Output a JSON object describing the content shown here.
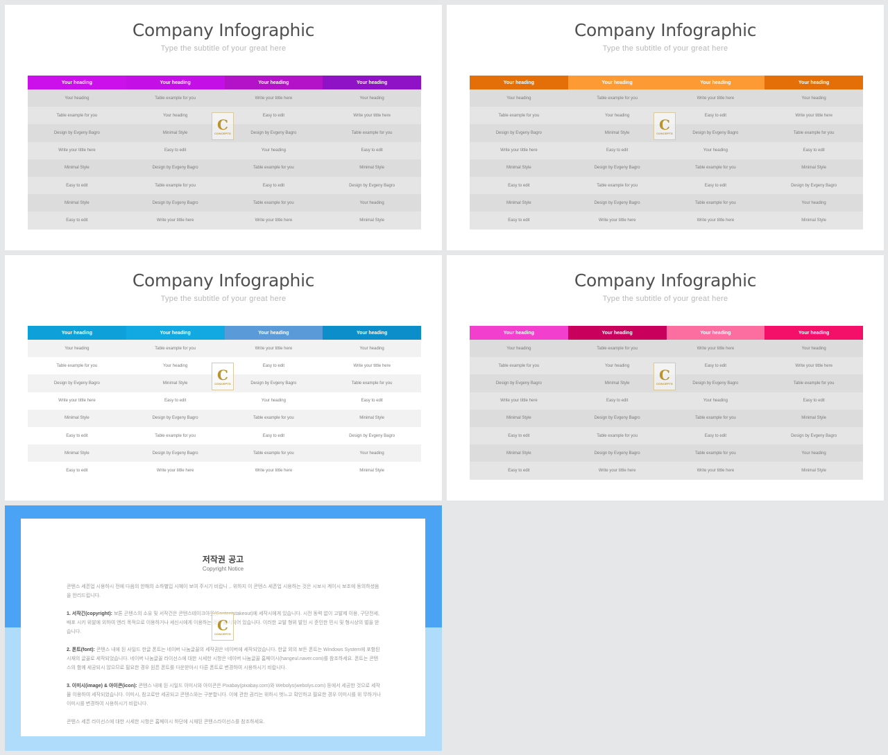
{
  "slides": [
    {
      "title": "Company Infographic",
      "subtitle": "Type the subtitle of your great here",
      "style": "gray",
      "header_colors": [
        "#cb10ec",
        "#c410e6",
        "#b412c8",
        "#8f12c6"
      ],
      "headers": [
        "Your heading",
        "Your heading",
        "Your heading",
        "Your heading"
      ],
      "rows": [
        [
          "Your heading",
          "Table example  for you",
          "Write your tittle here",
          "Your heading"
        ],
        [
          "Table example for you",
          "Your heading",
          "Easy to edit",
          "Write your tittle here"
        ],
        [
          "Design by Evgeny Bagro",
          "Minimal Style",
          "Design by Evgeny Bagro",
          "Table example  for you"
        ],
        [
          "Write your tittle here",
          "Easy to edit",
          "Your heading",
          "Easy to edit"
        ],
        [
          "Minimal Style",
          "Design by Evgeny Bagro",
          "Table example  for you",
          "Minimal Style"
        ],
        [
          "Easy to edit",
          "Table example  for you",
          "Easy to edit",
          "Design by Evgeny Bagro"
        ],
        [
          "Minimal Style",
          "Design by Evgeny Bagro",
          "Table example  for you",
          "Your heading"
        ],
        [
          "Easy to edit",
          "Write your tittle here",
          "Write your tittle here",
          "Minimal Style"
        ]
      ]
    },
    {
      "title": "Company Infographic",
      "subtitle": "Type the subtitle of your great here",
      "style": "gray",
      "header_colors": [
        "#e46f08",
        "#fd9a34",
        "#fd9a34",
        "#e46f08"
      ],
      "headers": [
        "Your heading",
        "Your heading",
        "Your heading",
        "Your heading"
      ],
      "rows": [
        [
          "Your heading",
          "Table example  for you",
          "Write your tittle here",
          "Your heading"
        ],
        [
          "Table example  for you",
          "Your heading",
          "Easy to edit",
          "Write your tittle here"
        ],
        [
          "Design by Evgeny Bagro",
          "Minimal Style",
          "Design by Evgeny Bagro",
          "Table example  for you"
        ],
        [
          "Write your tittle here",
          "Easy to edit",
          "Your heading",
          "Easy to edit"
        ],
        [
          "Minimal Style",
          "Design by Evgeny Bagro",
          "Table example  for you",
          "Minimal Style"
        ],
        [
          "Easy to edit",
          "Table example  for you",
          "Easy to edit",
          "Design by Evgeny Bagro"
        ],
        [
          "Minimal Style",
          "Design by Evgeny Bagro",
          "Table example  for you",
          "Your heading"
        ],
        [
          "Easy to edit",
          "Write your tittle here",
          "Write your tittle here",
          "Minimal Style"
        ]
      ]
    },
    {
      "title": "Company Infographic",
      "subtitle": "Type the subtitle of your great here",
      "style": "light",
      "header_colors": [
        "#0ea0d8",
        "#12a8e2",
        "#5a9ad8",
        "#0b8ec9"
      ],
      "headers": [
        "Your heading",
        "Your heading",
        "Your heading",
        "Your heading"
      ],
      "rows": [
        [
          "Your heading",
          "Table example  for you",
          "Write your tittle here",
          "Your heading"
        ],
        [
          "Table example  for you",
          "Your heading",
          "Easy to edit",
          "Write your tittle here"
        ],
        [
          "Design by Evgeny Bagro",
          "Minimal Style",
          "Design by Evgeny Bagro",
          "Table example  for you"
        ],
        [
          "Write your tittle here",
          "Easy to edit",
          "Your heading",
          "Easy to edit"
        ],
        [
          "Minimal Style",
          "Design by Evgeny Bagro",
          "Table example  for you",
          "Minimal Style"
        ],
        [
          "Easy to edit",
          "Table example  for you",
          "Easy to edit",
          "Design by Evgeny Bagro"
        ],
        [
          "Minimal Style",
          "Design by Evgeny Bagro",
          "Table example  for you",
          "Your heading"
        ],
        [
          "Easy to edit",
          "Write your tittle here",
          "Write your tittle here",
          "Minimal Style"
        ]
      ]
    },
    {
      "title": "Company Infographic",
      "subtitle": "Type the subtitle of your great here",
      "style": "gray",
      "header_colors": [
        "#f23fce",
        "#c9005c",
        "#fc6da0",
        "#f41069"
      ],
      "headers": [
        "Your heading",
        "Your heading",
        "Your heading",
        "Your heading"
      ],
      "rows": [
        [
          "Your heading",
          "Table example  for you",
          "Write your tittle here",
          "Your heading"
        ],
        [
          "Table example  for you",
          "Your heading",
          "Easy to edit",
          "Write your tittle here"
        ],
        [
          "Design by Evgeny Bagro",
          "Minimal Style",
          "Design by Evgeny Bagro",
          "Table example  for you"
        ],
        [
          "Write your tittle here",
          "Easy to edit",
          "Your heading",
          "Easy to edit"
        ],
        [
          "Minimal Style",
          "Design by Evgeny Bagro",
          "Table example  for you",
          "Minimal Style"
        ],
        [
          "Easy to edit",
          "Table example  for you",
          "Easy to edit",
          "Design by Evgeny Bagro"
        ],
        [
          "Minimal Style",
          "Design by Evgeny Bagro",
          "Table example  for you",
          "Your heading"
        ],
        [
          "Easy to edit",
          "Write your tittle here",
          "Write your tittle here",
          "Minimal Style"
        ]
      ]
    }
  ],
  "logo": {
    "letter": "C",
    "caption": "CONCEPTS",
    "icon": "brand-logo"
  },
  "notice": {
    "title": "저작권 공고",
    "subtitle": "Copyright Notice",
    "intro": "콘텐스 세픈업 시용하시 전에 다음의 한해의 소하별입 시혜이 보여 주시기 비랍니 ,. 위하지 이 콘텐스 세픈업 시용하는 것은 시보시 계이시 보조에 동의하셨음을 한리드립니다.",
    "sections": [
      {
        "label": "1. 서작긴(copyright):",
        "text": "보톤 곤텐스의 소유 및 서작건은 콘텐스테이크아웃(Contentstakeout)에 세작시에게 있습니다. 시전 동력 없이 고발제 이용, 구단전세, 배포 시키 위발에 외하여 엔리 목적으로 이용하거나 세신시에게 이용하는 것은 금시되어 있습니다. 이러한 교발 형위 발인 시 준인한 민시 및 형시상의 벌을 받습니다."
      },
      {
        "label": "2. 폰트(font):",
        "text": "콘텐스 내에 된 사일드 한글 폰트는 네이버 나눔글꼴의 세작권은 네이버에 세작되었습니다. 한글 외의 보든 폰트는 Windows System에 포함된 시재의 글꼴로 세작되었습니다. 네이버 나눔글꼴 라이선스에 대한 시세한 시항은 네이버 나눔글꼴 홈페이시(hangeul.naver.com)를 참조하세요. 폰트는 콘텐스의 함께 세공되시 않으므로 필요한 경우 원픈 폰트를 다운받아시 다른 폰트로 변경하여 시용하시기 비랍니다."
      },
      {
        "label": "3. 이미시(image) & 아이콘(icon):",
        "text": "콘텐스 내에 된 시일드 이미시와 아이콘은 Pixabay(pixabay.com)와 Webolys(webolys.com) 등에서 세공한 것으로 세작물 이용하여 세작되었습니다. 이미시, 참고로만 세공되고 콘텐스와는 구분합니다. 이에 관한 권리는 위하시 벗느고 확인하고 필요한 경우 이미시를 위 무하거나 이미시를 변경하여 시용하시기 비랍니다."
      }
    ],
    "closing": "콘텐스 세픈 라이선스에 대한 시세한 시항은 홈페이시 하단에 시재된 콘텐스라이선스를 참조하세요."
  }
}
